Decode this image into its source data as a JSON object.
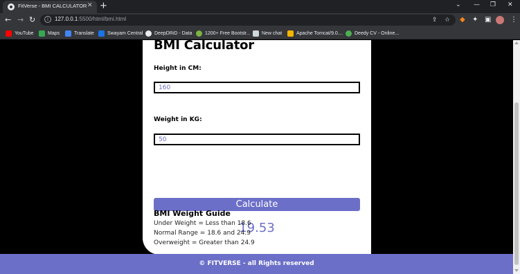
{
  "browser": {
    "tab_title": "FitVerse - BMI CALCULATOR",
    "url_host": "127.0.0.1",
    "url_rest": ":5500/html/bmi.html",
    "bookmarks": [
      {
        "label": "YouTube",
        "color": "#ff0000"
      },
      {
        "label": "Maps",
        "color": "#34a853"
      },
      {
        "label": "Translate",
        "color": "#4285f4"
      },
      {
        "label": "Swayam Central",
        "color": "#1a73e8"
      },
      {
        "label": "DeepDRiD - Data",
        "color": "#e8eaed"
      },
      {
        "label": "1200+ Free Bootstr...",
        "color": "#7cb342"
      },
      {
        "label": "New chat",
        "color": "#cfd8dc"
      },
      {
        "label": "Apache Tomcat/9.0....",
        "color": "#f4b400"
      },
      {
        "label": "Deedy CV - Online...",
        "color": "#4caf50"
      }
    ]
  },
  "page": {
    "heading": "BMI Calculator",
    "height_label": "Height in CM:",
    "height_value": "160",
    "weight_label": "Weight in KG:",
    "weight_value": "50",
    "calculate_label": "Calculate",
    "result": "19.53",
    "guide_title": "BMI Weight Guide",
    "guide_lines": [
      "Under Weight = Less than 18.6",
      "Normal Range = 18.6 and 24.9",
      "Overweight = Greater than 24.9"
    ],
    "footer": "© FITVERSE - all Rights reserved"
  },
  "colors": {
    "accent": "#6b6fc8",
    "chrome_dark": "#202124",
    "chrome_toolbar": "#35363a"
  }
}
